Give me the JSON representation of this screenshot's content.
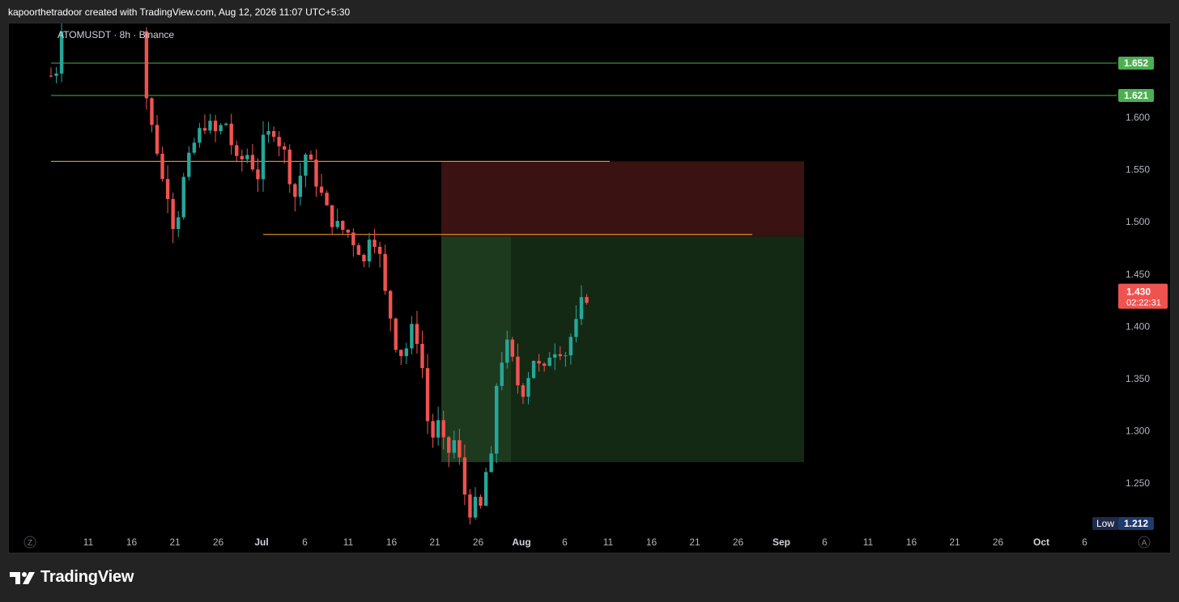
{
  "header": {
    "attribution": "kapoorthetradoor created with TradingView.com, Aug 12, 2026 11:07 UTC+5:30"
  },
  "footer": {
    "brand": "TradingView",
    "logo_icon": "tradingview-logo-icon"
  },
  "colors": {
    "up": "#26a69a",
    "down": "#ef5350",
    "level_green": "#4caf50",
    "level_orange": "#ffa726",
    "stop_zone": "#3a1212",
    "target_zone": "#1e3a1e",
    "target_zone_dark": "#142914"
  },
  "chart_data": {
    "type": "candlestick",
    "title": "ATOMUSDT · 8h · Binance",
    "symbol": "ATOMUSDT",
    "interval": "8h",
    "exchange": "Binance",
    "ylim": [
      1.205,
      1.69
    ],
    "y_ticks": [
      "1.250",
      "1.300",
      "1.350",
      "1.400",
      "1.450",
      "1.500",
      "1.550",
      "1.600"
    ],
    "x_ticks": [
      "11",
      "16",
      "21",
      "26",
      "Jul",
      "6",
      "11",
      "16",
      "21",
      "26",
      "Aug",
      "6",
      "11",
      "16",
      "21",
      "26",
      "Sep",
      "6",
      "11",
      "16",
      "21",
      "26",
      "Oct",
      "6"
    ],
    "x_tick_month_marks": [
      "Jul",
      "Aug",
      "Sep",
      "Oct"
    ],
    "horizontal_levels": [
      {
        "value": 1.652,
        "label": "1.652",
        "color": "#4caf50"
      },
      {
        "value": 1.621,
        "label": "1.621",
        "color": "#4caf50"
      },
      {
        "value": 1.558,
        "color": "#ffa726",
        "span": "partial"
      },
      {
        "value": 1.488,
        "color": "#ffa726",
        "span": "partial"
      }
    ],
    "position_box": {
      "entry": 1.486,
      "stop": 1.558,
      "target": 1.27
    },
    "current_price": {
      "value": 1.43,
      "label": "1.430",
      "countdown": "02:22:31"
    },
    "low_marker": {
      "label": "Low",
      "value": "1.212"
    },
    "series_path": [
      [
        0,
        1.64
      ],
      [
        0.6,
        1.62
      ],
      [
        1.2,
        1.66
      ],
      [
        2,
        1.69
      ],
      [
        17.5,
        1.69
      ],
      [
        18,
        1.62
      ],
      [
        19,
        1.59
      ],
      [
        20,
        1.57
      ],
      [
        21,
        1.54
      ],
      [
        22,
        1.53
      ],
      [
        23,
        1.5
      ],
      [
        24,
        1.51
      ],
      [
        25,
        1.54
      ],
      [
        27,
        1.575
      ],
      [
        29,
        1.595
      ],
      [
        31,
        1.585
      ],
      [
        33,
        1.595
      ],
      [
        35,
        1.555
      ],
      [
        37,
        1.565
      ],
      [
        39,
        1.545
      ],
      [
        40,
        1.575
      ],
      [
        42,
        1.59
      ],
      [
        44,
        1.565
      ],
      [
        46,
        1.525
      ],
      [
        48,
        1.565
      ],
      [
        50,
        1.54
      ],
      [
        52,
        1.51
      ],
      [
        54,
        1.495
      ],
      [
        56,
        1.49
      ],
      [
        58,
        1.475
      ],
      [
        59,
        1.46
      ],
      [
        60,
        1.49
      ],
      [
        61,
        1.485
      ],
      [
        62,
        1.465
      ],
      [
        63,
        1.43
      ],
      [
        64,
        1.41
      ],
      [
        65,
        1.385
      ],
      [
        66,
        1.375
      ],
      [
        67,
        1.38
      ],
      [
        68,
        1.395
      ],
      [
        69,
        1.39
      ],
      [
        70,
        1.36
      ],
      [
        71,
        1.31
      ],
      [
        72,
        1.295
      ],
      [
        73,
        1.305
      ],
      [
        74,
        1.285
      ],
      [
        75,
        1.28
      ],
      [
        76,
        1.29
      ],
      [
        77,
        1.27
      ],
      [
        78,
        1.24
      ],
      [
        79,
        1.225
      ],
      [
        80,
        1.228
      ],
      [
        81,
        1.225
      ],
      [
        82,
        1.26
      ],
      [
        83,
        1.27
      ],
      [
        84,
        1.345
      ],
      [
        85,
        1.37
      ],
      [
        86,
        1.38
      ],
      [
        87,
        1.365
      ],
      [
        88,
        1.345
      ],
      [
        89,
        1.34
      ],
      [
        90,
        1.355
      ],
      [
        91,
        1.37
      ],
      [
        92,
        1.36
      ],
      [
        93,
        1.355
      ],
      [
        94,
        1.375
      ],
      [
        95,
        1.38
      ],
      [
        96,
        1.38
      ],
      [
        97,
        1.375
      ],
      [
        98,
        1.39
      ],
      [
        99,
        1.4
      ],
      [
        100,
        1.42
      ],
      [
        101,
        1.43
      ]
    ]
  }
}
